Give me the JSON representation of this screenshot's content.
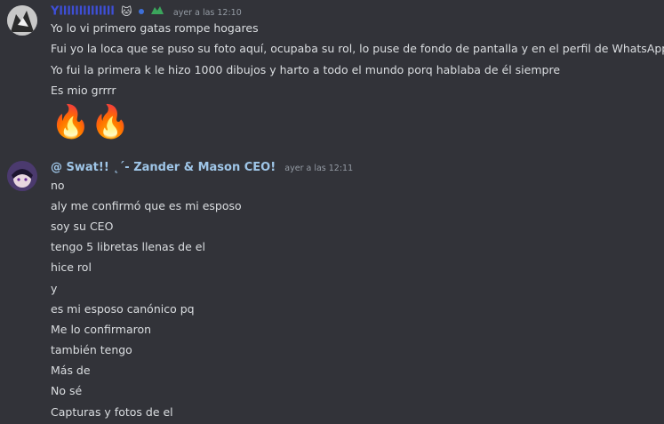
{
  "message1": {
    "username": "Yllllllllllllll",
    "timestamp": "ayer a las 12:10",
    "lines": [
      "Yo lo vi primero gatas rompe hogares",
      "Fui yo la loca que se puso su foto aquí, ocupaba su rol, lo puse de fondo de pantalla y en el perfil de WhatsApp",
      "Yo fui la primera k le hizo 1000 dibujos y harto a todo el mundo porq hablaba de él siempre",
      "Es mio grrrr"
    ],
    "emojis": [
      "🔥",
      "🔥"
    ]
  },
  "message2": {
    "username": "@ Swat!! ˛ˊ- Zander & Mason CEO!",
    "timestamp": "ayer a las 12:11",
    "lines": [
      "no",
      "aly me confirmó que es mi esposo",
      "soy su CEO",
      "tengo 5 libretas llenas de el",
      "hice rol",
      "y",
      "es mi esposo canónico pq",
      "Me lo confirmaron",
      "también tengo",
      "Más de",
      "No sé",
      "Capturas y fotos de el"
    ]
  },
  "colors": {
    "background": "#323339",
    "username1": "#3e4fd8",
    "username2": "#9fc6e8",
    "text": "#dbdee1",
    "timestamp": "#949ba4"
  }
}
